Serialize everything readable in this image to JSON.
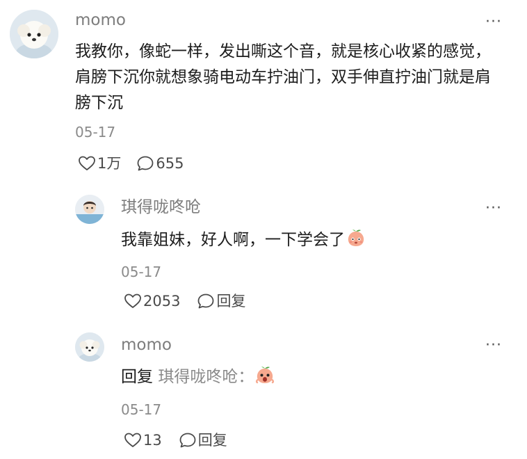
{
  "comments": [
    {
      "username": "momo",
      "text": "我教你，像蛇一样，发出嘶这个音，就是核心收紧的感觉，肩膀下沉你就想象骑电动车拧油门，双手伸直拧油门就是肩膀下沉",
      "date": "05-17",
      "likes": "1万",
      "replies": "655",
      "more": "···"
    },
    {
      "username": "琪得咙咚呛",
      "text": "我靠姐妹，好人啊，一下学会了",
      "date": "05-17",
      "likes": "2053",
      "reply_label": "回复",
      "more": "···",
      "emoji": "peach-face-emoji"
    },
    {
      "username": "momo",
      "reply_prefix": "回复",
      "reply_to": "琪得咙咚呛：",
      "date": "05-17",
      "likes": "13",
      "reply_label": "回复",
      "more": "···",
      "emoji": "peach-surprised-emoji"
    }
  ],
  "colors": {
    "username": "#7d7d7d",
    "text": "#1c1c1c",
    "meta": "#8a8a8a",
    "peach": "#f6a98f"
  }
}
